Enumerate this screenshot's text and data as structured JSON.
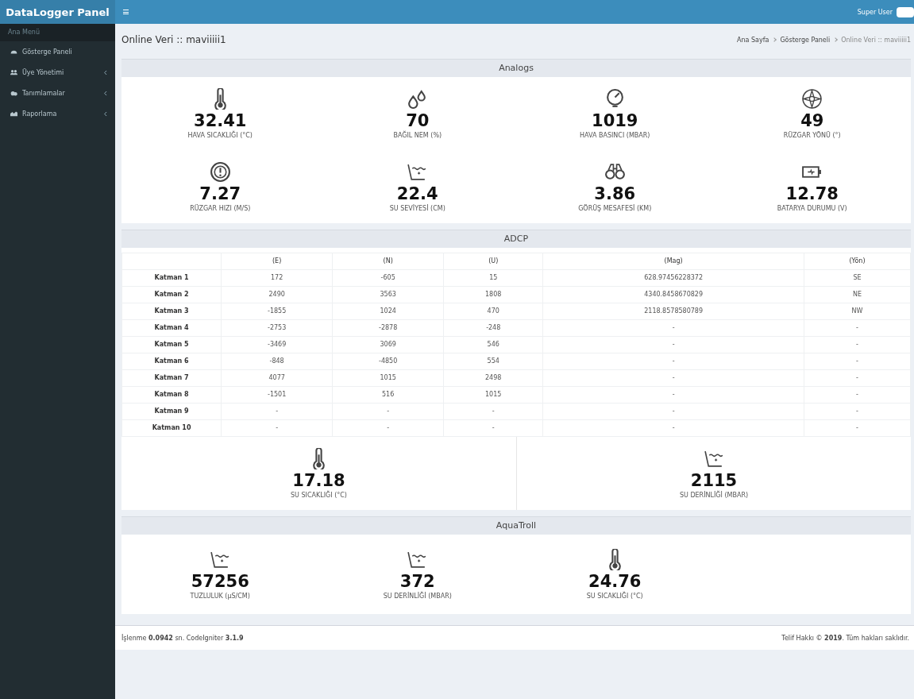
{
  "topbar": {
    "brand": "DataLogger Panel",
    "user": "Super User"
  },
  "sidebar": {
    "header": "Ana Menü",
    "items": [
      {
        "label": "Gösterge Paneli",
        "kind": "dashboard",
        "expandable": false
      },
      {
        "label": "Üye Yönetimi",
        "kind": "users",
        "expandable": true
      },
      {
        "label": "Tanımlamalar",
        "kind": "cloud",
        "expandable": true
      },
      {
        "label": "Raporlama",
        "kind": "chart",
        "expandable": true
      }
    ]
  },
  "page": {
    "title": "Online Veri :: maviiiii1",
    "breadcrumb": [
      "Ana Sayfa",
      "Gösterge Paneli",
      "Online Veri :: maviiiii1"
    ]
  },
  "analogs": {
    "heading": "Analogs",
    "items": [
      {
        "kind": "thermometer",
        "value": "32.41",
        "label": "HAVA SICAKLIĞI (°C)"
      },
      {
        "kind": "humidity",
        "value": "70",
        "label": "BAĞIL NEM (%)"
      },
      {
        "kind": "pressure",
        "value": "1019",
        "label": "HAVA BASINCI (MBAR)"
      },
      {
        "kind": "compass",
        "value": "49",
        "label": "RÜZGAR YÖNÜ (°)"
      },
      {
        "kind": "wind",
        "value": "7.27",
        "label": "RÜZGAR HIZI (M/S)"
      },
      {
        "kind": "level",
        "value": "22.4",
        "label": "SU SEVİYESİ (CM)"
      },
      {
        "kind": "visibility",
        "value": "3.86",
        "label": "GÖRÜŞ MESAFESİ (KM)"
      },
      {
        "kind": "battery",
        "value": "12.78",
        "label": "BATARYA DURUMU (V)"
      }
    ]
  },
  "adcp": {
    "heading": "ADCP",
    "table": {
      "columns": [
        "(E)",
        "(N)",
        "(U)",
        "(Mag)",
        "(Yön)"
      ],
      "rows": [
        {
          "label": "Katman 1",
          "cells": [
            "172",
            "-605",
            "15",
            "628.97456228372",
            "SE"
          ]
        },
        {
          "label": "Katman 2",
          "cells": [
            "2490",
            "3563",
            "1808",
            "4340.8458670829",
            "NE"
          ]
        },
        {
          "label": "Katman 3",
          "cells": [
            "-1855",
            "1024",
            "470",
            "2118.8578580789",
            "NW"
          ]
        },
        {
          "label": "Katman 4",
          "cells": [
            "-2753",
            "-2878",
            "-248",
            "-",
            "-"
          ]
        },
        {
          "label": "Katman 5",
          "cells": [
            "-3469",
            "3069",
            "546",
            "-",
            "-"
          ]
        },
        {
          "label": "Katman 6",
          "cells": [
            "-848",
            "-4850",
            "554",
            "-",
            "-"
          ]
        },
        {
          "label": "Katman 7",
          "cells": [
            "4077",
            "1015",
            "2498",
            "-",
            "-"
          ]
        },
        {
          "label": "Katman 8",
          "cells": [
            "-1501",
            "516",
            "1015",
            "-",
            "-"
          ]
        },
        {
          "label": "Katman 9",
          "cells": [
            "-",
            "-",
            "-",
            "-",
            "-"
          ]
        },
        {
          "label": "Katman 10",
          "cells": [
            "-",
            "-",
            "-",
            "-",
            "-"
          ]
        }
      ]
    },
    "items": [
      {
        "kind": "thermometer",
        "value": "17.18",
        "label": "SU SICAKLIĞI (°C)"
      },
      {
        "kind": "level",
        "value": "2115",
        "label": "SU DERİNLİĞİ (MBAR)"
      }
    ]
  },
  "aquatroll": {
    "heading": "AquaTroll",
    "items": [
      {
        "kind": "level",
        "value": "57256",
        "label": "TUZLULUK (µS/CM)"
      },
      {
        "kind": "level",
        "value": "372",
        "label": "SU DERİNLİĞİ (MBAR)"
      },
      {
        "kind": "thermometer",
        "value": "24.76",
        "label": "SU SICAKLIĞI (°C)"
      }
    ]
  },
  "footer": {
    "left": "İşlenme **0.0942** sn. CodeIgniter **3.1.9**",
    "right": "Telif Hakkı © **2019**. Tüm hakları saklıdır."
  }
}
